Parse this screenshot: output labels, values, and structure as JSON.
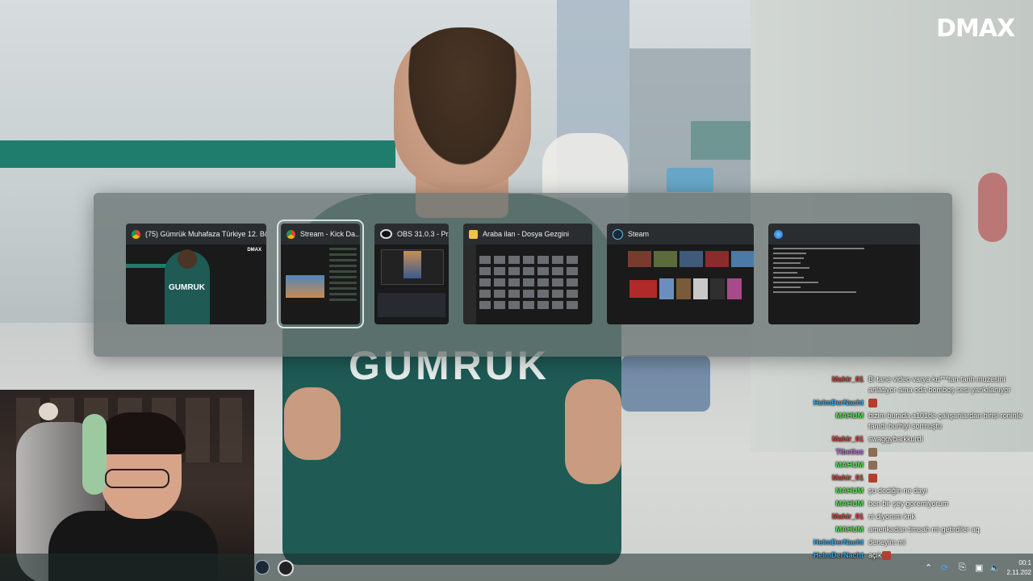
{
  "brand": {
    "logo": "DMAX"
  },
  "video": {
    "shirt_text": "GUMRUK"
  },
  "alt_tab": {
    "windows": [
      {
        "title": "(75) Gümrük Muhafaza Türkiye 12. Böl...",
        "icon": "chrome-icon",
        "thumb_text": "GUMRUK",
        "thumb_logo": "DMAX",
        "selected": false
      },
      {
        "title": "Stream - Kick Da...",
        "icon": "chrome-icon",
        "selected": true
      },
      {
        "title": "OBS 31.0.3 - Pr...",
        "icon": "obs-icon",
        "selected": false
      },
      {
        "title": "Araba ilan - Dosya Gezgini",
        "icon": "folder-icon",
        "selected": false
      },
      {
        "title": "Steam",
        "icon": "steam-icon",
        "selected": false
      },
      {
        "title": "",
        "icon": "globe-icon",
        "selected": false
      }
    ]
  },
  "chat": {
    "messages": [
      {
        "user": "Mahir_01",
        "color": "#d94040",
        "text": "Bi tane video varya ku***tan tarih muzesini anlatıyor ama oda bomboş sesi yankılanıyor",
        "emote": ""
      },
      {
        "user": "HelmDerNacht",
        "color": "#3aa6e8",
        "text": "",
        "emote": "red"
      },
      {
        "user": "MAHUM",
        "color": "#5ee05e",
        "text": "bizim burada a101de çalışanlardan birisi roninle tanıdı burhiyi sormuştu",
        "emote": ""
      },
      {
        "user": "Mahir_01",
        "color": "#d94040",
        "text": "swaggybarkkurdi",
        "emote": ""
      },
      {
        "user": "Tibetius",
        "color": "#c070e0",
        "text": "",
        "emote": "brown"
      },
      {
        "user": "MAHUM",
        "color": "#5ee05e",
        "text": "",
        "emote": "brown"
      },
      {
        "user": "Mahir_01",
        "color": "#d94040",
        "text": "",
        "emote": "red"
      },
      {
        "user": "MAHUM",
        "color": "#5ee05e",
        "text": "şu dediğin ne dayı",
        "emote": ""
      },
      {
        "user": "MAHUM",
        "color": "#5ee05e",
        "text": "ben bir şey goremiyorum",
        "emote": ""
      },
      {
        "user": "Mahir_01",
        "color": "#d94040",
        "text": "ni diyorum knk",
        "emote": ""
      },
      {
        "user": "MAHUM",
        "color": "#5ee05e",
        "text": "amerikadan timsah mi getirdiler aq",
        "emote": ""
      },
      {
        "user": "HelmDerNacht",
        "color": "#3aa6e8",
        "text": "deneyim mi",
        "emote": ""
      },
      {
        "user": "HelmDerNacht",
        "color": "#3aa6e8",
        "text": "açık",
        "emote": "red"
      }
    ]
  },
  "taskbar": {
    "clock_time": "00:1",
    "clock_date": "2.11.202"
  }
}
